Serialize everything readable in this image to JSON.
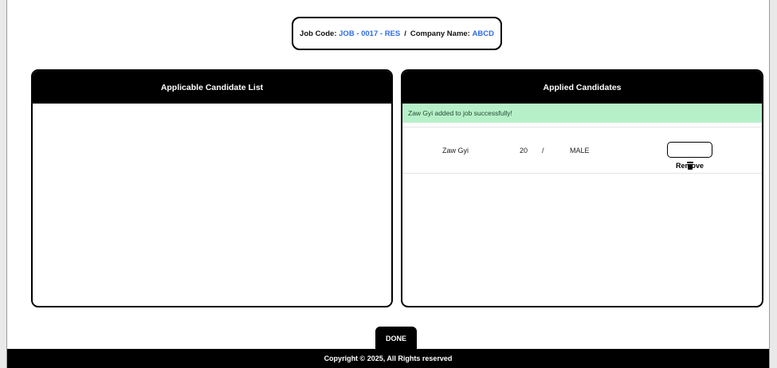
{
  "job": {
    "code_label": "Job Code:",
    "code_value": "JOB - 0017 - RES",
    "separator": "/",
    "company_label": "Company Name:",
    "company_value": "ABCD"
  },
  "left_panel": {
    "title": "Applicable Candidate List"
  },
  "right_panel": {
    "title": "Applied Candidates",
    "alert": "Zaw Gyi added to job successfully!",
    "candidates": [
      {
        "name": "Zaw Gyi",
        "age": "20",
        "slash": "/",
        "gender": "MALE",
        "remove_label": "Remove",
        "remove_icon": "trash-icon"
      }
    ]
  },
  "done_label": "DONE",
  "footer": "Copyright © 2025, All Rights reserved",
  "colors": {
    "accent": "#2f6ce5",
    "alert_bg": "#b6f0c9",
    "header_bg": "#000000"
  }
}
